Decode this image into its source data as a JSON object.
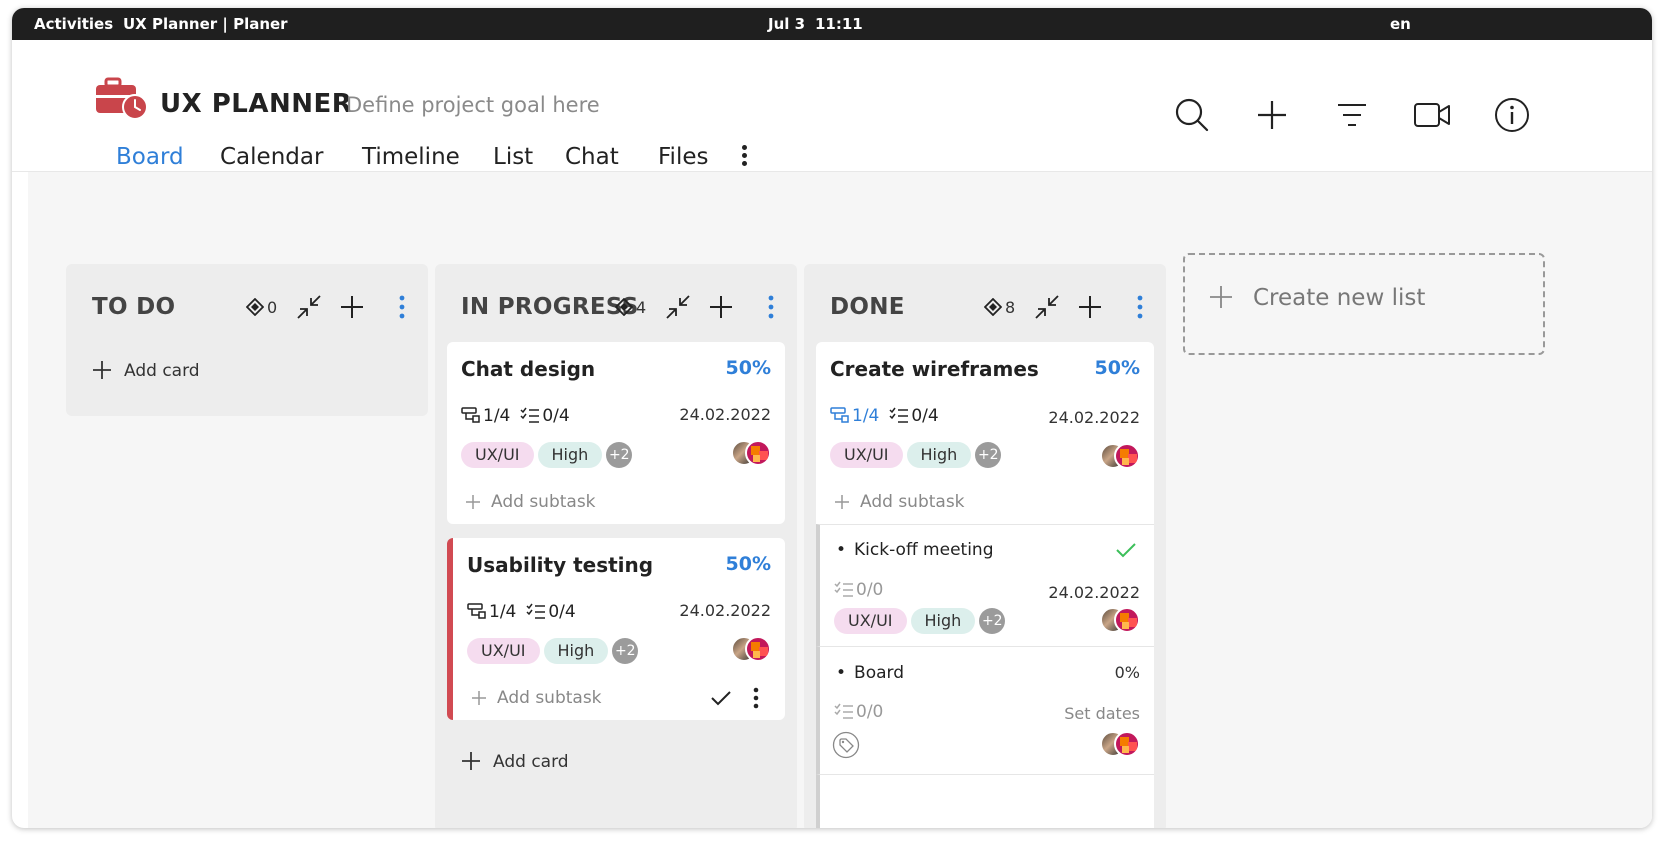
{
  "system_bar": {
    "activities": "Activities",
    "app_name": "UX Planner | Planer",
    "date": "Jul 3",
    "time": "11:11",
    "language": "en"
  },
  "header": {
    "title": "UX PLANNER",
    "goal_placeholder": "Define project goal here",
    "icons": [
      "search-icon",
      "plus-icon",
      "filter-icon",
      "video-icon",
      "info-icon"
    ],
    "brand_color": "#c9454b",
    "accent_color": "#2f7fd8"
  },
  "tabs": [
    {
      "label": "Board",
      "active": true
    },
    {
      "label": "Calendar",
      "active": false
    },
    {
      "label": "Timeline",
      "active": false
    },
    {
      "label": "List",
      "active": false
    },
    {
      "label": "Chat",
      "active": false
    },
    {
      "label": "Files",
      "active": false
    }
  ],
  "columns": [
    {
      "title": "TO DO",
      "count": "0",
      "add_card": "Add card",
      "cards": []
    },
    {
      "title": "IN PROGRESS",
      "count": "4",
      "add_card": "Add card",
      "cards": [
        {
          "title": "Chat design",
          "percent": "50%",
          "attachments": "1/4",
          "checklist": "0/4",
          "date": "24.02.2022",
          "tags": [
            "UX/UI",
            "High",
            "+2"
          ],
          "add_subtask": "Add subtask"
        },
        {
          "title": "Usability testing",
          "percent": "50%",
          "attachments": "1/4",
          "checklist": "0/4",
          "date": "24.02.2022",
          "tags": [
            "UX/UI",
            "High",
            "+2"
          ],
          "add_subtask": "Add subtask",
          "flag_color": "#d14a52"
        }
      ]
    },
    {
      "title": "DONE",
      "count": "8",
      "cards": [
        {
          "title": "Create wireframes",
          "percent": "50%",
          "attachments": "1/4",
          "checklist": "0/4",
          "date": "24.02.2022",
          "tags": [
            "UX/UI",
            "High",
            "+2"
          ],
          "add_subtask": "Add subtask",
          "subtasks": [
            {
              "name": "Kick-off meeting",
              "done": true,
              "checklist": "0/0",
              "date": "24.02.2022",
              "tags": [
                "UX/UI",
                "High",
                "+2"
              ]
            },
            {
              "name": "Board",
              "percent": "0%",
              "checklist": "0/0",
              "set_dates": "Set dates"
            }
          ]
        }
      ]
    }
  ],
  "create_list": "Create new list"
}
